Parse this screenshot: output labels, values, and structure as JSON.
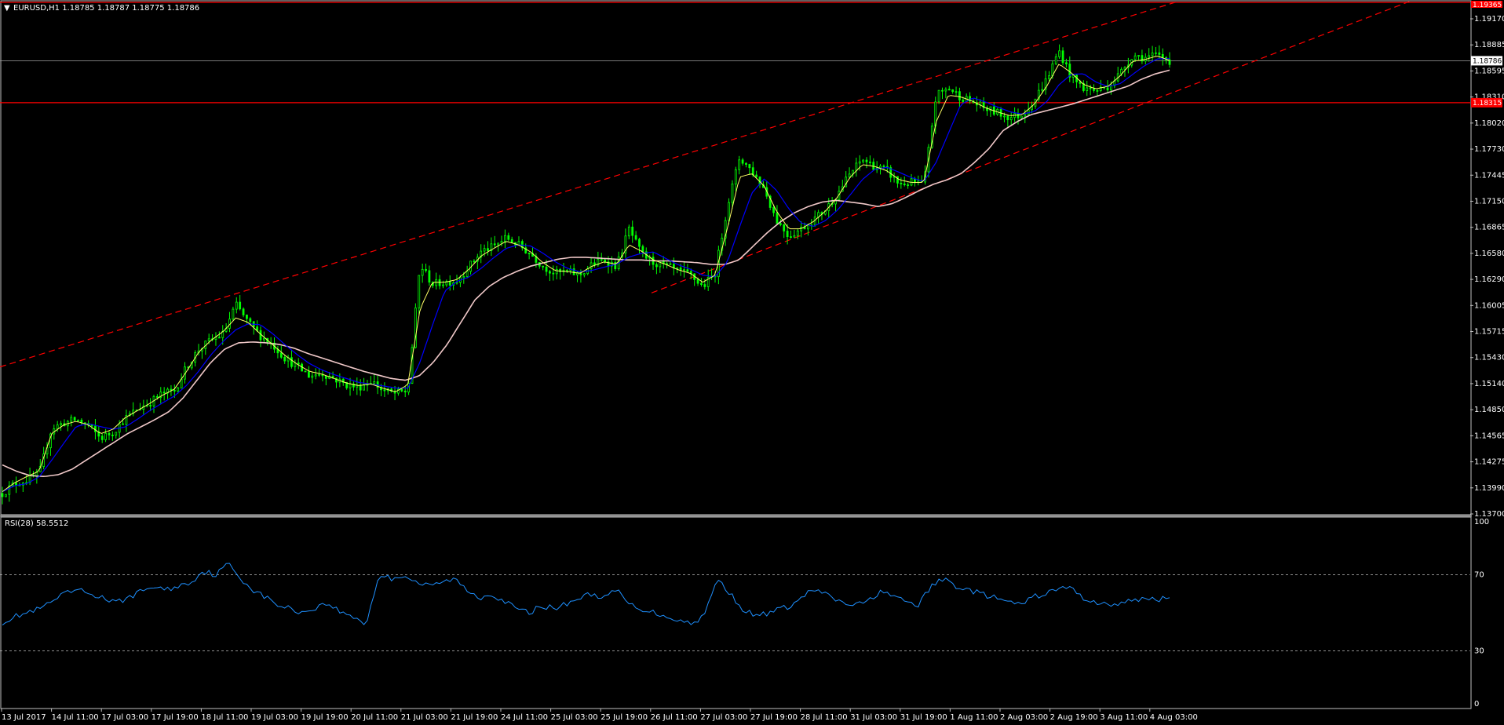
{
  "window": {
    "symbol_header": "EURUSD,H1  1.18785 1.18787 1.18775 1.18786"
  },
  "rsi_panel": {
    "header": "RSI(28) 58.5512"
  },
  "colors": {
    "background": "#000000",
    "candle": "#00ff00",
    "fast_ma": "#ffff66",
    "mid_ma": "#0000ff",
    "slow_ma": "#f0c8c8",
    "channel": "#ff0000",
    "rsi_line": "#1e90ff",
    "grid_text": "#ffffff",
    "level_line": "#ff0000"
  },
  "chart_data": [
    {
      "type": "candlestick",
      "title": "EURUSD,H1",
      "ylim": [
        1.137,
        1.1945
      ],
      "y_ticks": [
        "1.19170",
        "1.18885",
        "1.18595",
        "1.18310",
        "1.18020",
        "1.17730",
        "1.17445",
        "1.17150",
        "1.16865",
        "1.16580",
        "1.16290",
        "1.16005",
        "1.15715",
        "1.15430",
        "1.15140",
        "1.14850",
        "1.14565",
        "1.14275",
        "1.13990",
        "1.13700"
      ],
      "x_ticks": [
        "13 Jul 2017",
        "14 Jul 11:00",
        "17 Jul 03:00",
        "17 Jul 19:00",
        "18 Jul 11:00",
        "19 Jul 03:00",
        "19 Jul 19:00",
        "20 Jul 11:00",
        "21 Jul 03:00",
        "21 Jul 19:00",
        "24 Jul 11:00",
        "25 Jul 03:00",
        "25 Jul 19:00",
        "26 Jul 11:00",
        "27 Jul 03:00",
        "27 Jul 19:00",
        "28 Jul 11:00",
        "31 Jul 03:00",
        "31 Jul 19:00",
        "1 Aug 11:00",
        "2 Aug 03:00",
        "2 Aug 19:00",
        "3 Aug 11:00",
        "4 Aug 03:00"
      ],
      "price_anchors": [
        1.1393,
        1.1404,
        1.1408,
        1.1415,
        1.1466,
        1.1472,
        1.1476,
        1.1469,
        1.1455,
        1.1462,
        1.1477,
        1.1488,
        1.1495,
        1.1505,
        1.1508,
        1.1535,
        1.1555,
        1.1565,
        1.1572,
        1.1605,
        1.1585,
        1.157,
        1.156,
        1.1545,
        1.1535,
        1.1525,
        1.1528,
        1.1522,
        1.1515,
        1.1512,
        1.152,
        1.1508,
        1.1505,
        1.1508,
        1.165,
        1.1628,
        1.163,
        1.1632,
        1.1648,
        1.1665,
        1.167,
        1.168,
        1.1672,
        1.1662,
        1.1648,
        1.164,
        1.1642,
        1.1638,
        1.165,
        1.1655,
        1.1648,
        1.169,
        1.1662,
        1.1652,
        1.1648,
        1.1642,
        1.1638,
        1.1625,
        1.164,
        1.1715,
        1.177,
        1.1755,
        1.1735,
        1.17,
        1.1682,
        1.169,
        1.17,
        1.1712,
        1.173,
        1.1752,
        1.1768,
        1.176,
        1.1755,
        1.174,
        1.1742,
        1.174,
        1.184,
        1.1848,
        1.1838,
        1.1832,
        1.1825,
        1.182,
        1.1815,
        1.1818,
        1.1835,
        1.1858,
        1.189,
        1.186,
        1.1848,
        1.1845,
        1.185,
        1.1865,
        1.1885,
        1.1882,
        1.1885,
        1.18786
      ],
      "fast_ma_anchors": [
        1.1395,
        1.1405,
        1.1412,
        1.1418,
        1.146,
        1.147,
        1.1474,
        1.147,
        1.146,
        1.1465,
        1.1478,
        1.1486,
        1.1494,
        1.1503,
        1.151,
        1.153,
        1.1552,
        1.1565,
        1.1575,
        1.159,
        1.1585,
        1.1572,
        1.156,
        1.1548,
        1.1538,
        1.153,
        1.1527,
        1.1522,
        1.1517,
        1.1514,
        1.1516,
        1.1511,
        1.1507,
        1.1515,
        1.16,
        1.163,
        1.163,
        1.1633,
        1.1645,
        1.166,
        1.1668,
        1.1676,
        1.1672,
        1.1664,
        1.1652,
        1.1643,
        1.1642,
        1.164,
        1.1648,
        1.1653,
        1.165,
        1.1672,
        1.1665,
        1.1655,
        1.165,
        1.1644,
        1.164,
        1.163,
        1.1638,
        1.169,
        1.1748,
        1.1752,
        1.1738,
        1.171,
        1.169,
        1.169,
        1.1698,
        1.171,
        1.1726,
        1.1748,
        1.1762,
        1.176,
        1.1755,
        1.1745,
        1.1742,
        1.1742,
        1.181,
        1.184,
        1.1838,
        1.1833,
        1.1826,
        1.1821,
        1.1817,
        1.1818,
        1.183,
        1.185,
        1.1875,
        1.1865,
        1.1852,
        1.1847,
        1.185,
        1.1862,
        1.1878,
        1.188,
        1.1884,
        1.1879
      ],
      "slow_ma_anchors": [
        1.1425,
        1.1418,
        1.1413,
        1.1412,
        1.1414,
        1.142,
        1.143,
        1.144,
        1.145,
        1.146,
        1.1468,
        1.1476,
        1.1485,
        1.15,
        1.152,
        1.154,
        1.1555,
        1.1562,
        1.1563,
        1.1562,
        1.156,
        1.1556,
        1.155,
        1.1545,
        1.154,
        1.1535,
        1.153,
        1.1526,
        1.1522,
        1.152,
        1.1525,
        1.154,
        1.156,
        1.1585,
        1.161,
        1.1625,
        1.1635,
        1.1642,
        1.1648,
        1.1652,
        1.1656,
        1.1658,
        1.1658,
        1.1657,
        1.1656,
        1.1655,
        1.1655,
        1.1654,
        1.1654,
        1.1653,
        1.1652,
        1.165,
        1.165,
        1.1655,
        1.167,
        1.1685,
        1.1698,
        1.1708,
        1.1715,
        1.172,
        1.1722,
        1.172,
        1.1718,
        1.1715,
        1.1718,
        1.1725,
        1.1733,
        1.174,
        1.1745,
        1.1752,
        1.1765,
        1.178,
        1.18,
        1.181,
        1.1818,
        1.1822,
        1.1826,
        1.183,
        1.1835,
        1.184,
        1.1845,
        1.185,
        1.1858,
        1.1864,
        1.1868
      ],
      "current_price": "1.18786",
      "level_price": "1.18315",
      "top_level_price": "1.19365",
      "current_price_value": 1.18786,
      "level_price_value": 1.18315,
      "top_level_price_value": 1.19365,
      "channel_upper_start": 1.1535,
      "channel_upper_end": 1.1945,
      "channel_lower_start": 1.1618,
      "channel_lower_end": 1.1945,
      "channel_lower_end_x_fraction": 0.9585
    },
    {
      "type": "line",
      "title": "RSI(28) 58.5512",
      "ylim": [
        0,
        100
      ],
      "y_ticks": [
        "100",
        "70",
        "30",
        "0"
      ],
      "levels": [
        70,
        30
      ],
      "rsi_anchors": [
        45,
        48,
        50,
        52,
        56,
        60,
        62,
        60,
        58,
        55,
        58,
        61,
        64,
        62,
        64,
        66,
        72,
        70,
        76,
        68,
        62,
        58,
        54,
        52,
        50,
        53,
        55,
        50,
        48,
        44,
        70,
        68,
        70,
        66,
        64,
        66,
        68,
        62,
        58,
        60,
        56,
        52,
        50,
        54,
        52,
        55,
        58,
        60,
        58,
        62,
        54,
        52,
        50,
        48,
        46,
        44,
        50,
        68,
        60,
        52,
        48,
        50,
        52,
        54,
        60,
        62,
        58,
        55,
        54,
        56,
        62,
        58,
        56,
        54,
        64,
        68,
        64,
        62,
        60,
        58,
        56,
        54,
        58,
        60,
        62,
        64,
        58,
        56,
        54,
        55,
        56,
        58,
        57,
        58.55
      ]
    }
  ]
}
